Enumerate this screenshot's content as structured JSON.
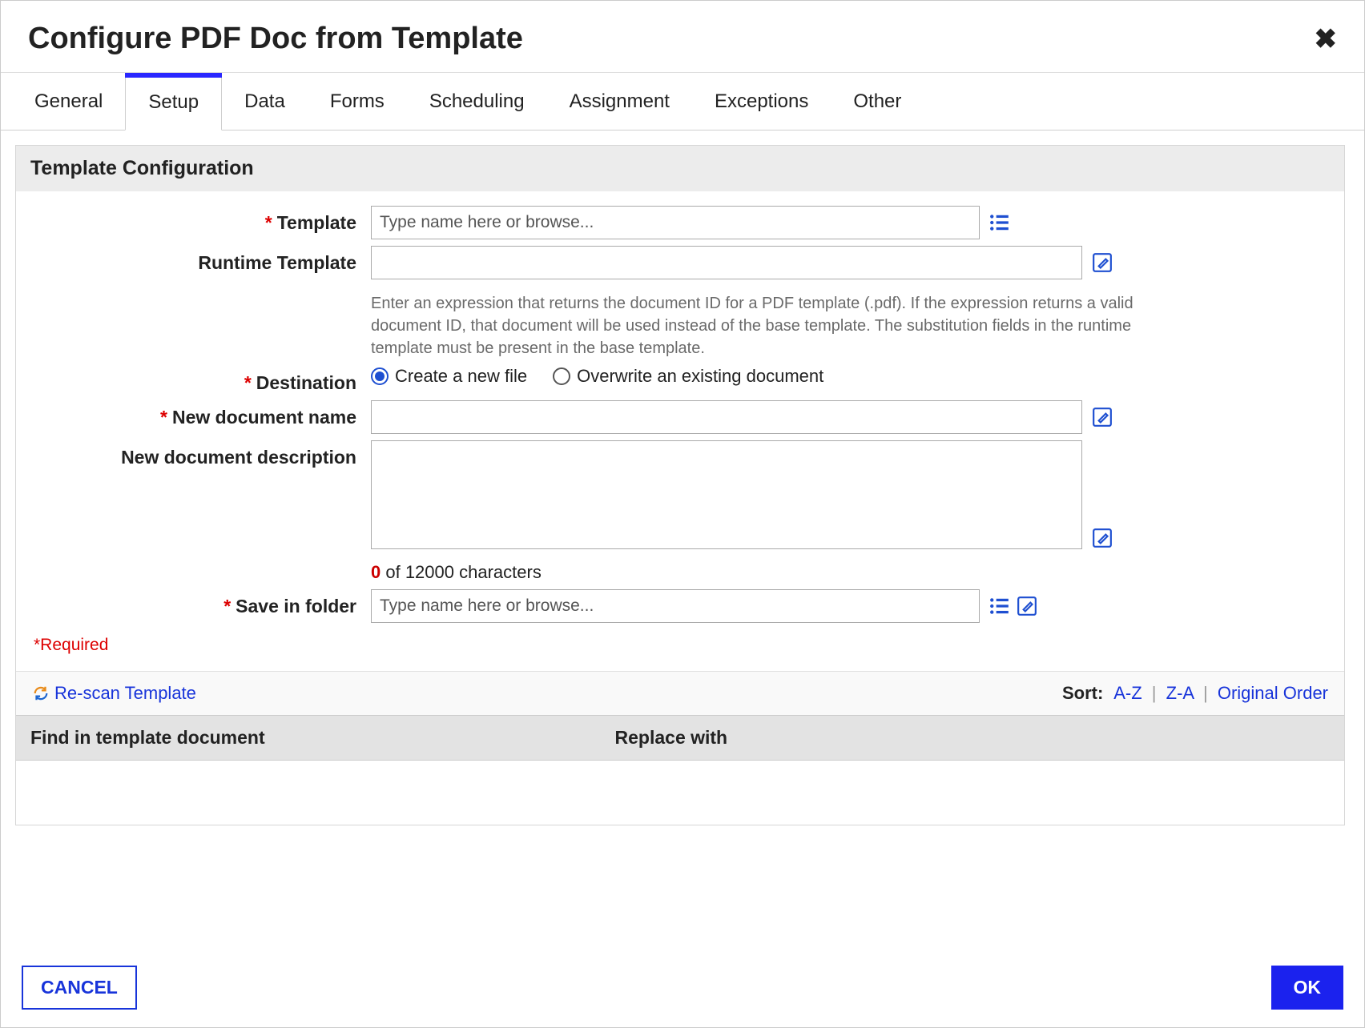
{
  "header": {
    "title": "Configure PDF Doc from Template"
  },
  "tabs": {
    "items": [
      "General",
      "Setup",
      "Data",
      "Forms",
      "Scheduling",
      "Assignment",
      "Exceptions",
      "Other"
    ],
    "active_index": 1
  },
  "section": {
    "title": "Template Configuration",
    "template_label": "Template",
    "template_placeholder": "Type name here or browse...",
    "runtime_label": "Runtime Template",
    "runtime_value": "",
    "runtime_help": "Enter an expression that returns the document ID for a PDF template (.pdf). If the expression returns a valid document ID, that document will be used instead of the base template. The substitution fields in the runtime template must be present in the base template.",
    "destination_label": "Destination",
    "destination_opts": {
      "create": "Create a new file",
      "overwrite": "Overwrite an existing document"
    },
    "newdoc_label": "New document name",
    "newdoc_value": "",
    "desc_label": "New document description",
    "desc_value": "",
    "char_count": "0",
    "char_rest": " of 12000 characters",
    "folder_label": "Save in folder",
    "folder_placeholder": "Type name here or browse...",
    "required_note": "*Required"
  },
  "toolbar": {
    "rescan": "Re-scan Template",
    "sort_label": "Sort:",
    "sort_az": "A-Z",
    "sort_za": "Z-A",
    "sort_orig": "Original Order"
  },
  "grid": {
    "col1": "Find in template document",
    "col2": "Replace with"
  },
  "footer": {
    "cancel": "CANCEL",
    "ok": "OK"
  }
}
